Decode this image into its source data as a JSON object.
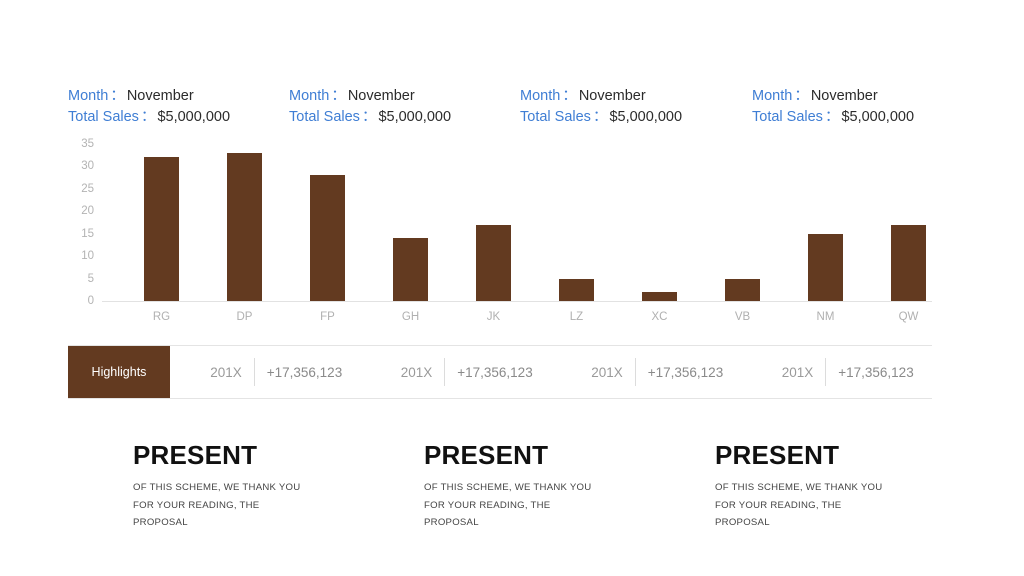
{
  "summary": {
    "blocks": [
      {
        "month_label": "Month",
        "separator": "：",
        "month_value": "November",
        "sales_label": "Total Sales",
        "sales_value": "$5,000,000"
      },
      {
        "month_label": "Month",
        "separator": "：",
        "month_value": "November",
        "sales_label": "Total Sales",
        "sales_value": "$5,000,000"
      },
      {
        "month_label": "Month",
        "separator": "：",
        "month_value": "November",
        "sales_label": "Total Sales",
        "sales_value": "$5,000,000"
      },
      {
        "month_label": "Month",
        "separator": "：",
        "month_value": "November",
        "sales_label": "Total Sales",
        "sales_value": "$5,000,000"
      }
    ]
  },
  "chart_data": {
    "type": "bar",
    "title": "",
    "xlabel": "",
    "ylabel": "",
    "ylim": [
      0,
      35
    ],
    "yticks": [
      0,
      5,
      10,
      15,
      20,
      25,
      30,
      35
    ],
    "grid": false,
    "legend": "none",
    "bar_color": "#633a20",
    "categories": [
      "RG",
      "DP",
      "FP",
      "GH",
      "JK",
      "LZ",
      "XC",
      "VB",
      "NM",
      "QW"
    ],
    "values": [
      32,
      33,
      28,
      14,
      17,
      5,
      2,
      5,
      15,
      17
    ]
  },
  "highlights": {
    "badge_label": "Highlights",
    "badge_color": "#633a20",
    "items": [
      {
        "year": "201X",
        "amount": "+17,356,123"
      },
      {
        "year": "201X",
        "amount": "+17,356,123"
      },
      {
        "year": "201X",
        "amount": "+17,356,123"
      },
      {
        "year": "201X",
        "amount": "+17,356,123"
      }
    ]
  },
  "bottom": {
    "blocks": [
      {
        "title": "PRESENT",
        "line1": "OF THIS SCHEME, WE THANK YOU",
        "line2": "FOR YOUR READING, THE",
        "line3": "PROPOSAL"
      },
      {
        "title": "PRESENT",
        "line1": "OF THIS SCHEME, WE THANK YOU",
        "line2": "FOR YOUR READING, THE",
        "line3": "PROPOSAL"
      },
      {
        "title": "PRESENT",
        "line1": "OF THIS SCHEME, WE THANK YOU",
        "line2": "FOR YOUR READING, THE",
        "line3": "PROPOSAL"
      }
    ]
  },
  "theme": {
    "accent_blue": "#3f7ed4",
    "brand_brown": "#633a20",
    "muted_gray": "#b0b0b0"
  }
}
